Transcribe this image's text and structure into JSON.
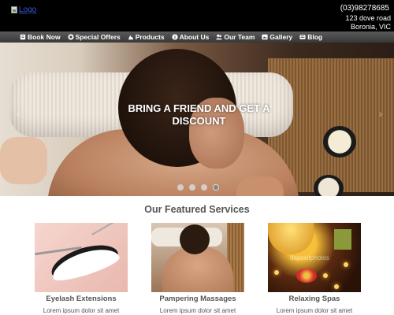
{
  "header": {
    "logo_alt": "Logo",
    "phone": "(03)98278685",
    "address_line1": "123 dove road",
    "address_line2": "Boronia, VIC"
  },
  "nav": {
    "items": [
      {
        "label": "Book Now",
        "icon": "book-icon"
      },
      {
        "label": "Special Offers",
        "icon": "gift-icon"
      },
      {
        "label": "Products",
        "icon": "products-icon"
      },
      {
        "label": "About Us",
        "icon": "info-icon"
      },
      {
        "label": "Our Team",
        "icon": "team-icon"
      },
      {
        "label": "Gallery",
        "icon": "gallery-icon"
      },
      {
        "label": "Blog",
        "icon": "blog-icon"
      }
    ]
  },
  "hero": {
    "caption": "BRING A FRIEND AND GET A DISCOUNT",
    "prev_arrow": "‹",
    "next_arrow": "›",
    "slide_count": 4,
    "active_slide": 4
  },
  "featured": {
    "title": "Our Featured Services",
    "cards": [
      {
        "title": "Eyelash Extensions",
        "desc": "Lorem ipsum dolor sit amet"
      },
      {
        "title": "Pampering Massages",
        "desc": "Lorem ipsum dolor sit amet"
      },
      {
        "title": "Relaxing Spas",
        "desc": "Lorem ipsum dolor sit amet"
      }
    ],
    "watermark": "depositphotos"
  },
  "colors": {
    "header_bg": "#000000",
    "nav_bg": "#444444",
    "text_gray": "#555555"
  }
}
